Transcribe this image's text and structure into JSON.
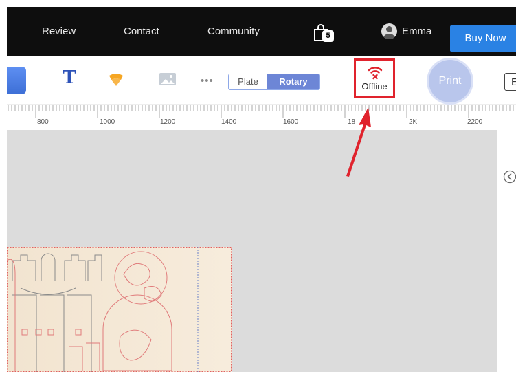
{
  "nav": {
    "links": [
      "Review",
      "Contact",
      "Community"
    ],
    "cart_count": "5",
    "user_name": "Emma",
    "buy_now": "Buy Now"
  },
  "toolbar": {
    "text_tool_glyph": "T",
    "more_glyph": "•••",
    "mode_plate": "Plate",
    "mode_rotary": "Rotary",
    "status_label": "Offline",
    "print_label": "Print",
    "edge_button_label": "E"
  },
  "ruler": {
    "labels": [
      "800",
      "1000",
      "1200",
      "1400",
      "1600",
      "18",
      "2K",
      "2200"
    ]
  },
  "colors": {
    "nav_bg": "#0e0e0e",
    "accent": "#2a82e4",
    "rotary_active": "#6d86d6",
    "offline_red": "#e0232d",
    "canvas_bg": "#dcdcdc"
  },
  "icons": [
    "shopping-bag-icon",
    "user-avatar-icon",
    "text-tool-icon",
    "shape-tool-icon",
    "image-tool-icon",
    "wifi-off-icon",
    "collapse-panel-icon",
    "annotation-arrow-icon"
  ]
}
